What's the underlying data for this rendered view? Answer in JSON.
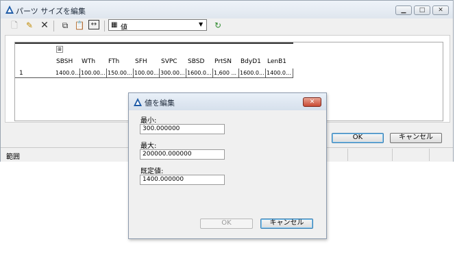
{
  "main_window": {
    "title": "パーツ サイズを編集",
    "toolbar": {
      "filter_value": "値"
    },
    "grid": {
      "columns": [
        "SBSH",
        "WTh",
        "FTh",
        "SFH",
        "SVPC",
        "SBSD",
        "PrtSN",
        "BdyD1",
        "LenB1"
      ],
      "expand_glyph": "⊞",
      "rows": [
        {
          "index": "1",
          "cells": [
            "1400.0...",
            "100.00...",
            "150.00...",
            "100.00...",
            "300.00...",
            "1600.0...",
            "1,600 ...",
            "1600.0...",
            "1400.0..."
          ]
        }
      ]
    },
    "ok_label": "OK",
    "cancel_label": "キャンセル",
    "status_text": "範囲"
  },
  "dialog": {
    "title": "値を編集",
    "min_label": "最小:",
    "min_value": "300.000000",
    "max_label": "最大:",
    "max_value": "200000.000000",
    "default_label": "既定値:",
    "default_value": "1400.000000",
    "ok_label": "OK",
    "cancel_label": "キャンセル"
  },
  "colors": {
    "accent": "#3c7fb1",
    "close_button": "#c94a34"
  }
}
